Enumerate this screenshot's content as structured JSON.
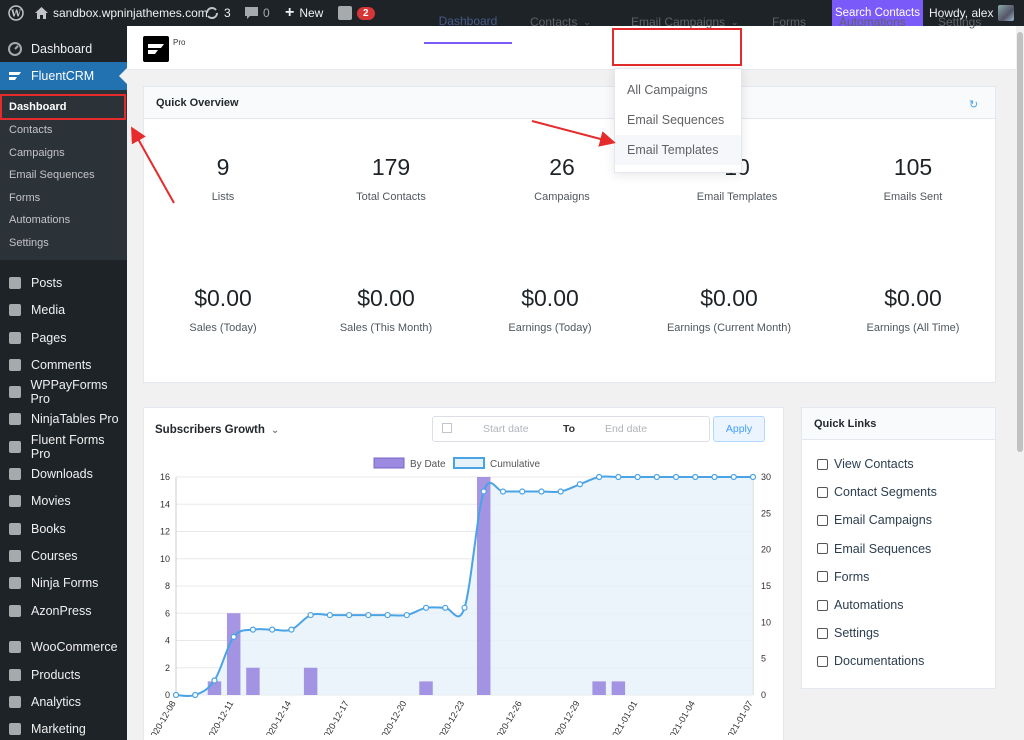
{
  "admin_bar": {
    "site_name": "sandbox.wpninjathemes.com",
    "updates_count": "3",
    "comments_count": "0",
    "new_label": "New",
    "notification_badge": "2",
    "search_contacts": "Search Contacts",
    "howdy": "Howdy, alex"
  },
  "sidebar": {
    "dashboard": "Dashboard",
    "fluentcrm": "FluentCRM",
    "submenu": [
      "Dashboard",
      "Contacts",
      "Campaigns",
      "Email Sequences",
      "Forms",
      "Automations",
      "Settings"
    ],
    "items": [
      "Posts",
      "Media",
      "Pages",
      "Comments",
      "WPPayForms Pro",
      "NinjaTables Pro",
      "Fluent Forms Pro",
      "Downloads",
      "Movies",
      "Books",
      "Courses",
      "Ninja Forms",
      "AzonPress"
    ],
    "items2": [
      "WooCommerce",
      "Products",
      "Analytics",
      "Marketing"
    ]
  },
  "topnav": {
    "logo_pro": "Pro",
    "tabs": [
      "Dashboard",
      "Contacts",
      "Email Campaigns",
      "Forms",
      "Automations",
      "Settings"
    ]
  },
  "dropdown": [
    "All Campaigns",
    "Email Sequences",
    "Email Templates"
  ],
  "overview": {
    "title": "Quick Overview",
    "stats": [
      {
        "value": "9",
        "label": "Lists"
      },
      {
        "value": "179",
        "label": "Total Contacts"
      },
      {
        "value": "26",
        "label": "Campaigns"
      },
      {
        "value": "10",
        "label": "Email Templates"
      },
      {
        "value": "105",
        "label": "Emails Sent"
      }
    ],
    "money": [
      {
        "value": "$0.00",
        "label": "Sales (Today)"
      },
      {
        "value": "$0.00",
        "label": "Sales (This Month)"
      },
      {
        "value": "$0.00",
        "label": "Earnings (Today)"
      },
      {
        "value": "$0.00",
        "label": "Earnings (Current Month)"
      },
      {
        "value": "$0.00",
        "label": "Earnings (All Time)"
      }
    ]
  },
  "growth": {
    "title": "Subscribers Growth",
    "start_placeholder": "Start date",
    "to_label": "To",
    "end_placeholder": "End date",
    "apply": "Apply"
  },
  "quick_links": {
    "title": "Quick Links",
    "items": [
      "View Contacts",
      "Contact Segments",
      "Email Campaigns",
      "Email Sequences",
      "Forms",
      "Automations",
      "Settings",
      "Documentations"
    ]
  },
  "chart_data": {
    "type": "bar",
    "legend": [
      "By Date",
      "Cumulative"
    ],
    "x": [
      "2020-12-08",
      "2020-12-09",
      "2020-12-10",
      "2020-12-11",
      "2020-12-12",
      "2020-12-13",
      "2020-12-14",
      "2020-12-15",
      "2020-12-16",
      "2020-12-17",
      "2020-12-18",
      "2020-12-19",
      "2020-12-20",
      "2020-12-21",
      "2020-12-22",
      "2020-12-23",
      "2020-12-24",
      "2020-12-25",
      "2020-12-26",
      "2020-12-27",
      "2020-12-28",
      "2020-12-29",
      "2020-12-30",
      "2020-12-31",
      "2021-01-01",
      "2021-01-02",
      "2021-01-03",
      "2021-01-04",
      "2021-01-05",
      "2021-01-06",
      "2021-01-07"
    ],
    "x_tick_labels": [
      "2020-12-08",
      "2020-12-11",
      "2020-12-14",
      "2020-12-17",
      "2020-12-20",
      "2020-12-23",
      "2020-12-26",
      "2020-12-29",
      "2021-01-01",
      "2021-01-04",
      "2021-01-07"
    ],
    "series": [
      {
        "name": "By Date",
        "values": [
          0,
          0,
          1,
          6,
          2,
          0,
          0,
          2,
          0,
          0,
          0,
          0,
          0,
          1,
          0,
          0,
          16,
          0,
          0,
          0,
          0,
          0,
          1,
          1,
          0,
          0,
          0,
          0,
          0,
          0,
          0
        ]
      },
      {
        "name": "Cumulative",
        "values": [
          0,
          0,
          2,
          8,
          9,
          9,
          9,
          11,
          11,
          11,
          11,
          11,
          11,
          12,
          12,
          12,
          28,
          28,
          28,
          28,
          28,
          29,
          30,
          30,
          30,
          30,
          30,
          30,
          30,
          30,
          30
        ]
      }
    ],
    "ylim_left": [
      0,
      16
    ],
    "yticks_left": [
      0,
      2,
      4,
      6,
      8,
      10,
      12,
      14,
      16
    ],
    "ylim_right": [
      0,
      30
    ],
    "yticks_right": [
      0,
      5,
      10,
      15,
      20,
      25,
      30
    ],
    "colors": {
      "bar": "#9b8ae0",
      "line": "#4aa3e4",
      "area": "#e6f1fa"
    }
  }
}
